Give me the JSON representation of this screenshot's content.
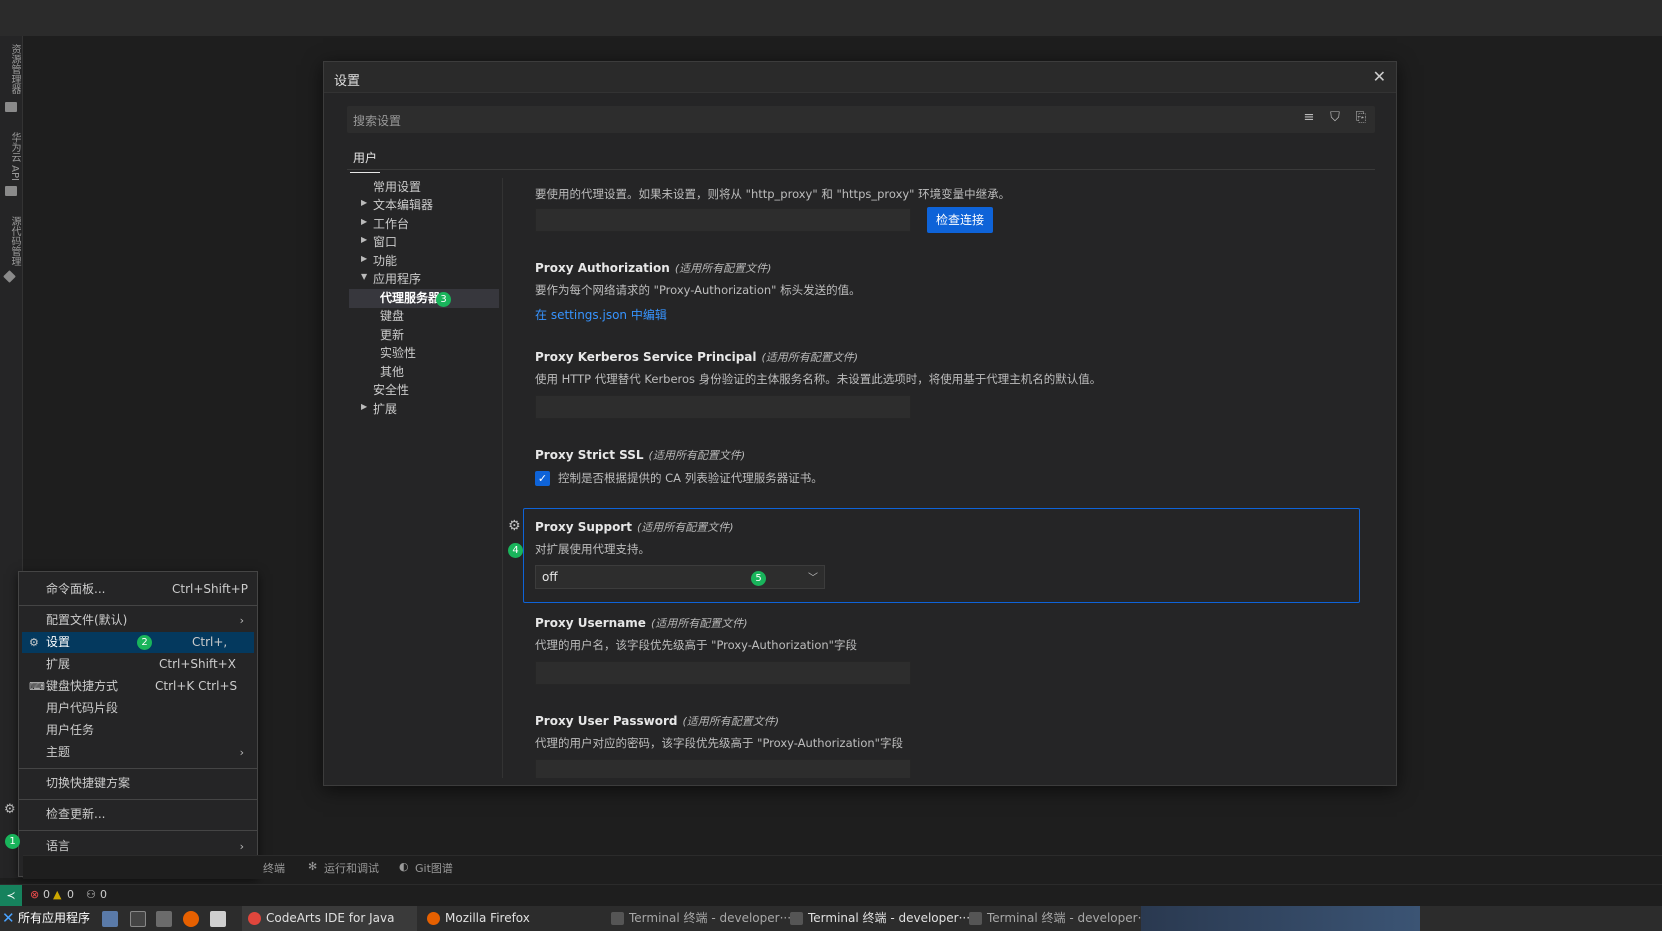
{
  "activity_bar": {
    "items": [
      "资源管理器",
      "华为云 API",
      "源代码管理"
    ]
  },
  "settings_dialog": {
    "title": "设置",
    "close_symbol": "✕",
    "search_placeholder": "搜索设置",
    "tabs": [
      "用户"
    ],
    "nav": [
      {
        "label": "常用设置",
        "indent": 1,
        "arrow": ""
      },
      {
        "label": "文本编辑器",
        "indent": 1,
        "arrow": "▶"
      },
      {
        "label": "工作台",
        "indent": 1,
        "arrow": "▶"
      },
      {
        "label": "窗口",
        "indent": 1,
        "arrow": "▶"
      },
      {
        "label": "功能",
        "indent": 1,
        "arrow": "▶"
      },
      {
        "label": "应用程序",
        "indent": 1,
        "arrow": "▼"
      },
      {
        "label": "代理服务器",
        "indent": 2,
        "arrow": "",
        "selected": true
      },
      {
        "label": "键盘",
        "indent": 2,
        "arrow": ""
      },
      {
        "label": "更新",
        "indent": 2,
        "arrow": ""
      },
      {
        "label": "实验性",
        "indent": 2,
        "arrow": ""
      },
      {
        "label": "其他",
        "indent": 2,
        "arrow": ""
      },
      {
        "label": "安全性",
        "indent": 1,
        "arrow": ""
      },
      {
        "label": "扩展",
        "indent": 1,
        "arrow": "▶"
      }
    ],
    "settings": {
      "proxy": {
        "desc": "要使用的代理设置。如果未设置，则将从 \"http_proxy\" 和 \"https_proxy\" 环境变量中继承。",
        "value": "",
        "button": "检查连接"
      },
      "proxy_authorization": {
        "title": "Proxy Authorization",
        "scope": "(适用所有配置文件)",
        "desc": "要作为每个网络请求的 \"Proxy-Authorization\" 标头发送的值。",
        "link": "在 settings.json 中编辑"
      },
      "proxy_kerberos": {
        "title": "Proxy Kerberos Service Principal",
        "scope": "(适用所有配置文件)",
        "desc": "使用 HTTP 代理替代 Kerberos 身份验证的主体服务名称。未设置此选项时，将使用基于代理主机名的默认值。",
        "value": ""
      },
      "proxy_strict_ssl": {
        "title": "Proxy Strict SSL",
        "scope": "(适用所有配置文件)",
        "checkbox_label": "控制是否根据提供的 CA 列表验证代理服务器证书。",
        "checked": true,
        "check_symbol": "✓"
      },
      "proxy_support": {
        "title": "Proxy Support",
        "scope": "(适用所有配置文件)",
        "desc": "对扩展使用代理支持。",
        "selected": "off"
      },
      "proxy_username": {
        "title": "Proxy Username",
        "scope": "(适用所有配置文件)",
        "desc": "代理的用户名，该字段优先级高于 \"Proxy-Authorization\"字段",
        "value": ""
      },
      "proxy_password": {
        "title": "Proxy User Password",
        "scope": "(适用所有配置文件)",
        "desc": "代理的用户对应的密码，该字段优先级高于 \"Proxy-Authorization\"字段"
      }
    }
  },
  "badges": {
    "b1": "1",
    "b2": "2",
    "b3": "3",
    "b4": "4",
    "b5": "5"
  },
  "context_menu": {
    "items": [
      {
        "label": "命令面板...",
        "shortcut": "Ctrl+Shift+P"
      },
      {
        "label": "配置文件(默认)",
        "submenu": "›"
      },
      {
        "label": "设置",
        "shortcut": "Ctrl+,",
        "icon": "⚙",
        "active": true
      },
      {
        "label": "扩展",
        "shortcut": "Ctrl+Shift+X"
      },
      {
        "label": "键盘快捷方式",
        "shortcut": "Ctrl+K Ctrl+S",
        "icon": "⌨"
      },
      {
        "label": "用户代码片段"
      },
      {
        "label": "用户任务"
      },
      {
        "label": "主题",
        "submenu": "›"
      },
      {
        "label": "切换快捷键方案"
      },
      {
        "label": "检查更新..."
      },
      {
        "label": "语言",
        "submenu": "›"
      }
    ]
  },
  "panel_tabs": [
    "终端",
    "运行和调试",
    "Git图谱"
  ],
  "status_bar": {
    "errors": "0",
    "warnings": "0",
    "ports": "0"
  },
  "taskbar": {
    "start": "所有应用程序",
    "windows": [
      "CodeArts IDE for Java",
      "Mozilla Firefox",
      "Terminal 终端 - developer···",
      "Terminal 终端 - developer···",
      "Terminal 终端 - developer···"
    ]
  },
  "colors": {
    "accent": "#0e63d8",
    "badge": "#19b45b",
    "link": "#3794ff"
  }
}
